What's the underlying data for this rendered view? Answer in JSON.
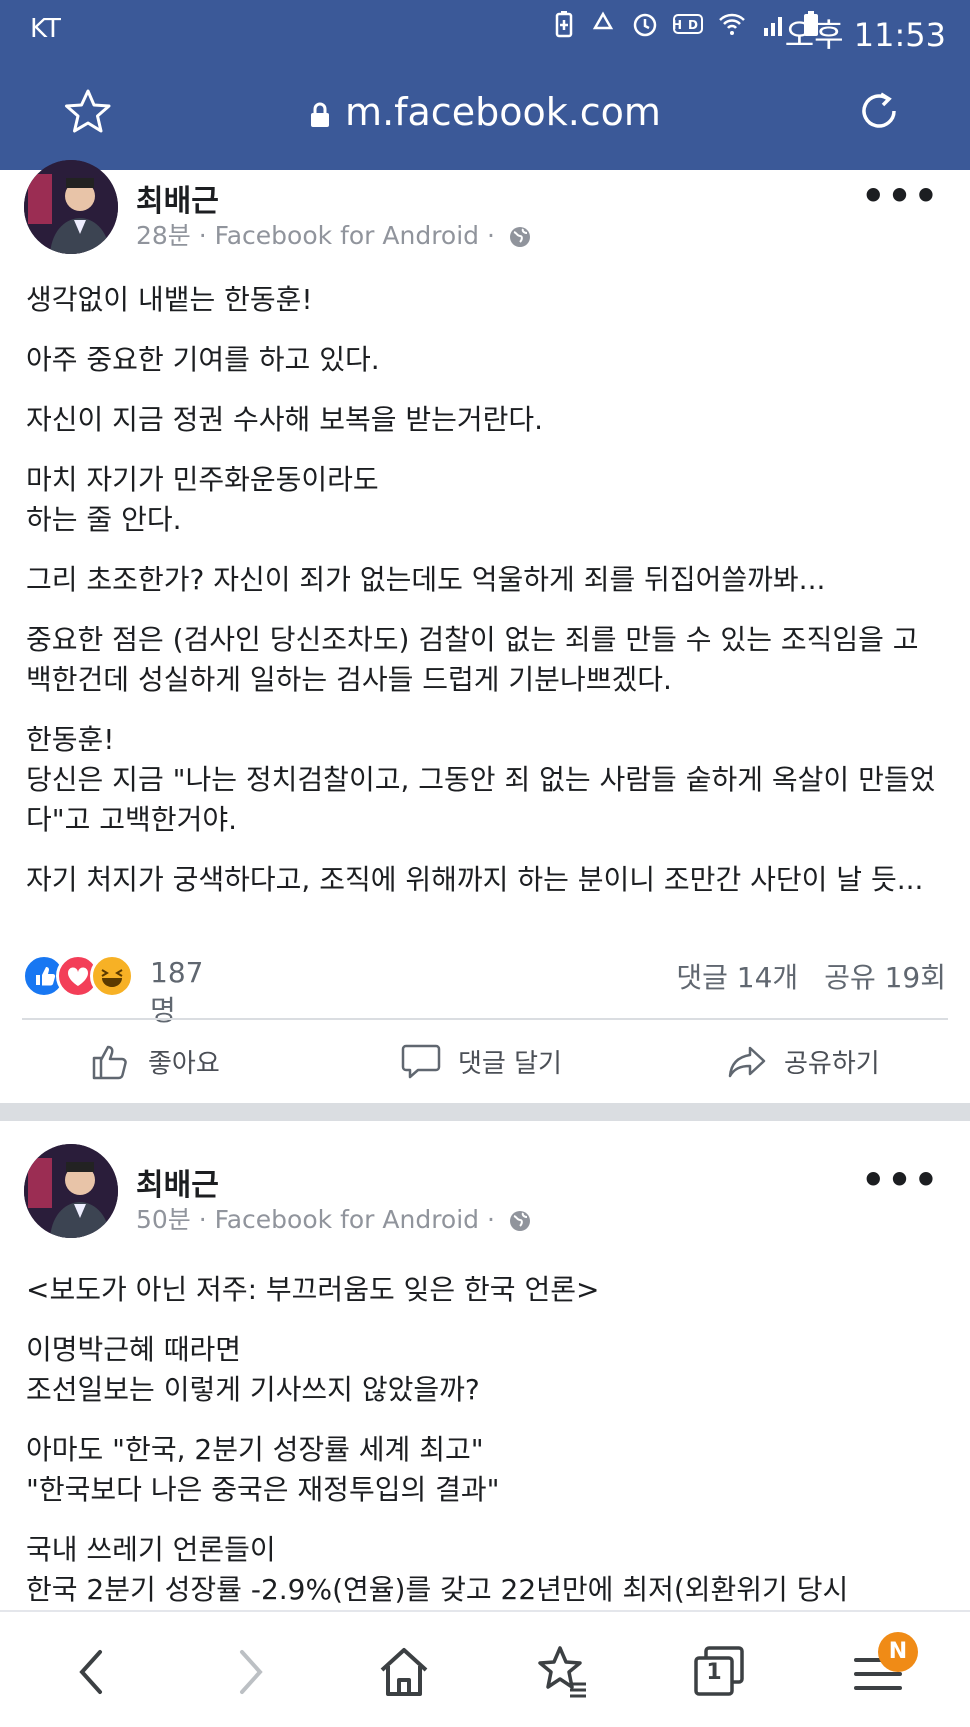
{
  "status_bar": {
    "carrier": "KT",
    "icons": [
      "battery-saver-icon",
      "recycle-icon",
      "alarm-icon",
      "hd-icon",
      "wifi-icon",
      "signal-icon",
      "battery-icon"
    ],
    "time": "오후 11:53"
  },
  "browser": {
    "url": "m.facebook.com",
    "badge": "N",
    "tab_count": "1"
  },
  "posts": [
    {
      "author": "최배근",
      "meta": "28분 · Facebook for Android ·",
      "paragraphs": [
        "생각없이 내뱉는 한동훈!",
        "아주 중요한 기여를 하고 있다.",
        "자신이 지금 정권 수사해 보복을 받는거란다.",
        "마치 자기가 민주화운동이라도\n하는 줄 안다.",
        "그리 초조한가? 자신이 죄가 없는데도 억울하게 죄를 뒤집어쓸까봐...",
        "중요한 점은 (검사인 당신조차도) 검찰이 없는 죄를 만들 수 있는 조직임을 고백한건데 성실하게 일하는 검사들 드럽게 기분나쁘겠다.",
        "한동훈!\n당신은 지금 \"나는 정치검찰이고, 그동안 죄 없는 사람들 숱하게 옥살이 만들었다\"고 고백한거야.",
        "자기 처지가 궁색하다고, 조직에 위해까지 하는 분이니 조만간 사단이 날 듯..."
      ],
      "reaction_count": "187명",
      "comments": "댓글 14개",
      "shares": "공유 19회",
      "actions": {
        "like": "좋아요",
        "comment": "댓글 달기",
        "share": "공유하기"
      }
    },
    {
      "author": "최배근",
      "meta": "50분 · Facebook for Android ·",
      "paragraphs": [
        "<보도가 아닌 저주: 부끄러움도 잊은 한국 언론>",
        "이명박근혜 때라면\n조선일보는 이렇게 기사쓰지 않았을까?",
        "아마도 \"한국, 2분기 성장률 세계 최고\"\n\"한국보다 나은 중국은 재정투입의 결과\"",
        "국내 쓰레기 언론들이\n한국 2분기 성장률 -2.9%(연율)를 갖고 22년만에 최저(외환위기 당시"
      ]
    }
  ],
  "colors": {
    "facebook_blue": "#3b5998",
    "like": "#1877f2",
    "love": "#f33e58",
    "haha": "#f7b125",
    "badge": "#f08b16"
  }
}
